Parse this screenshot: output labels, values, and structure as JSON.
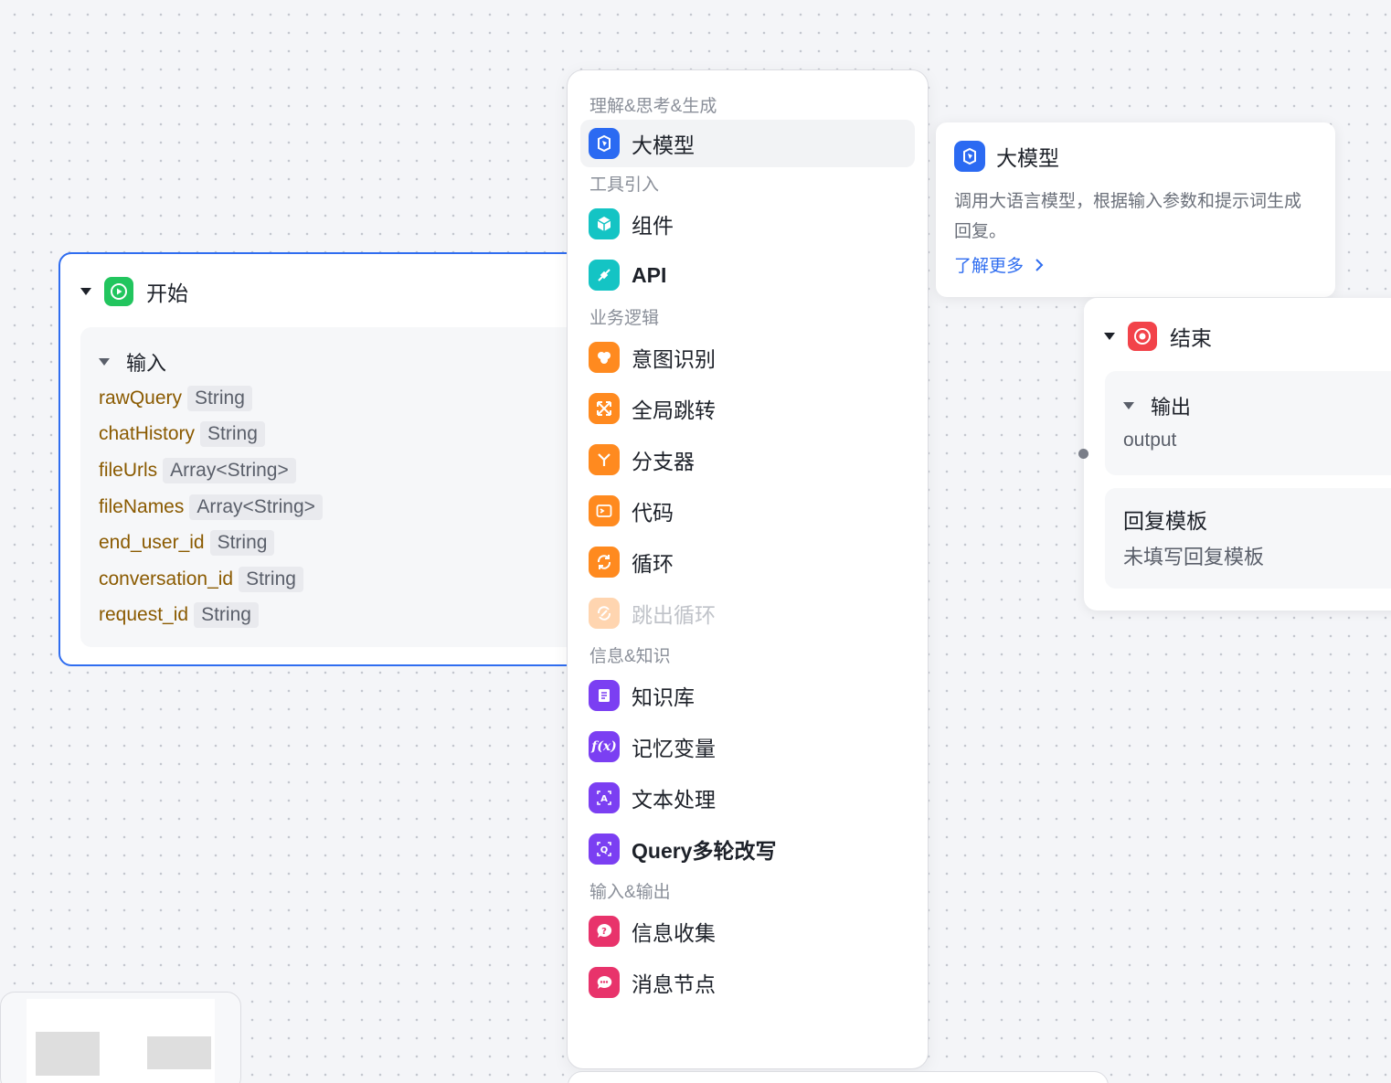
{
  "start_node": {
    "title": "开始",
    "input_label": "输入",
    "variables": [
      {
        "name": "rawQuery",
        "type": "String"
      },
      {
        "name": "chatHistory",
        "type": "String"
      },
      {
        "name": "fileUrls",
        "type": "Array<String>"
      },
      {
        "name": "fileNames",
        "type": "Array<String>"
      },
      {
        "name": "end_user_id",
        "type": "String"
      },
      {
        "name": "conversation_id",
        "type": "String"
      },
      {
        "name": "request_id",
        "type": "String"
      }
    ]
  },
  "menu": {
    "sections": [
      {
        "title": "理解&思考&生成",
        "items": [
          {
            "label": "大模型",
            "icon": "llm-icon",
            "color": "#2b6af2",
            "active": true
          }
        ]
      },
      {
        "title": "工具引入",
        "items": [
          {
            "label": "组件",
            "icon": "cube-icon",
            "color": "#14c4c4"
          },
          {
            "label": "API",
            "icon": "plug-icon",
            "color": "#14c4c4"
          }
        ]
      },
      {
        "title": "业务逻辑",
        "items": [
          {
            "label": "意图识别",
            "icon": "brain-icon",
            "color": "#ff8a1f"
          },
          {
            "label": "全局跳转",
            "icon": "expand-arrows-icon",
            "color": "#ff8a1f"
          },
          {
            "label": "分支器",
            "icon": "branch-icon",
            "color": "#ff8a1f"
          },
          {
            "label": "代码",
            "icon": "terminal-icon",
            "color": "#ff8a1f"
          },
          {
            "label": "循环",
            "icon": "loop-icon",
            "color": "#ff8a1f"
          },
          {
            "label": "跳出循环",
            "icon": "break-loop-icon",
            "color": "#ff8a1f",
            "disabled": true
          }
        ]
      },
      {
        "title": "信息&知识",
        "items": [
          {
            "label": "知识库",
            "icon": "document-icon",
            "color": "#7b3ff2"
          },
          {
            "label": "记忆变量",
            "icon": "function-icon",
            "color": "#7b3ff2"
          },
          {
            "label": "文本处理",
            "icon": "text-process-icon",
            "color": "#7b3ff2"
          },
          {
            "label": "Query多轮改写",
            "icon": "query-rewrite-icon",
            "color": "#7b3ff2"
          }
        ]
      },
      {
        "title": "输入&输出",
        "items": [
          {
            "label": "信息收集",
            "icon": "question-bubble-icon",
            "color": "#e8336b"
          },
          {
            "label": "消息节点",
            "icon": "chat-bubble-icon",
            "color": "#e8336b"
          }
        ]
      }
    ]
  },
  "tooltip": {
    "title": "大模型",
    "description": "调用大语言模型，根据输入参数和提示词生成回复。",
    "link": "了解更多"
  },
  "end_node": {
    "title": "结束",
    "output_label": "输出",
    "output_var": "output",
    "template_title": "回复模板",
    "template_value": "未填写回复模板"
  },
  "colors": {
    "accent": "#2f6df0",
    "start_icon": "#22c55e",
    "end_icon": "#f2434a"
  }
}
